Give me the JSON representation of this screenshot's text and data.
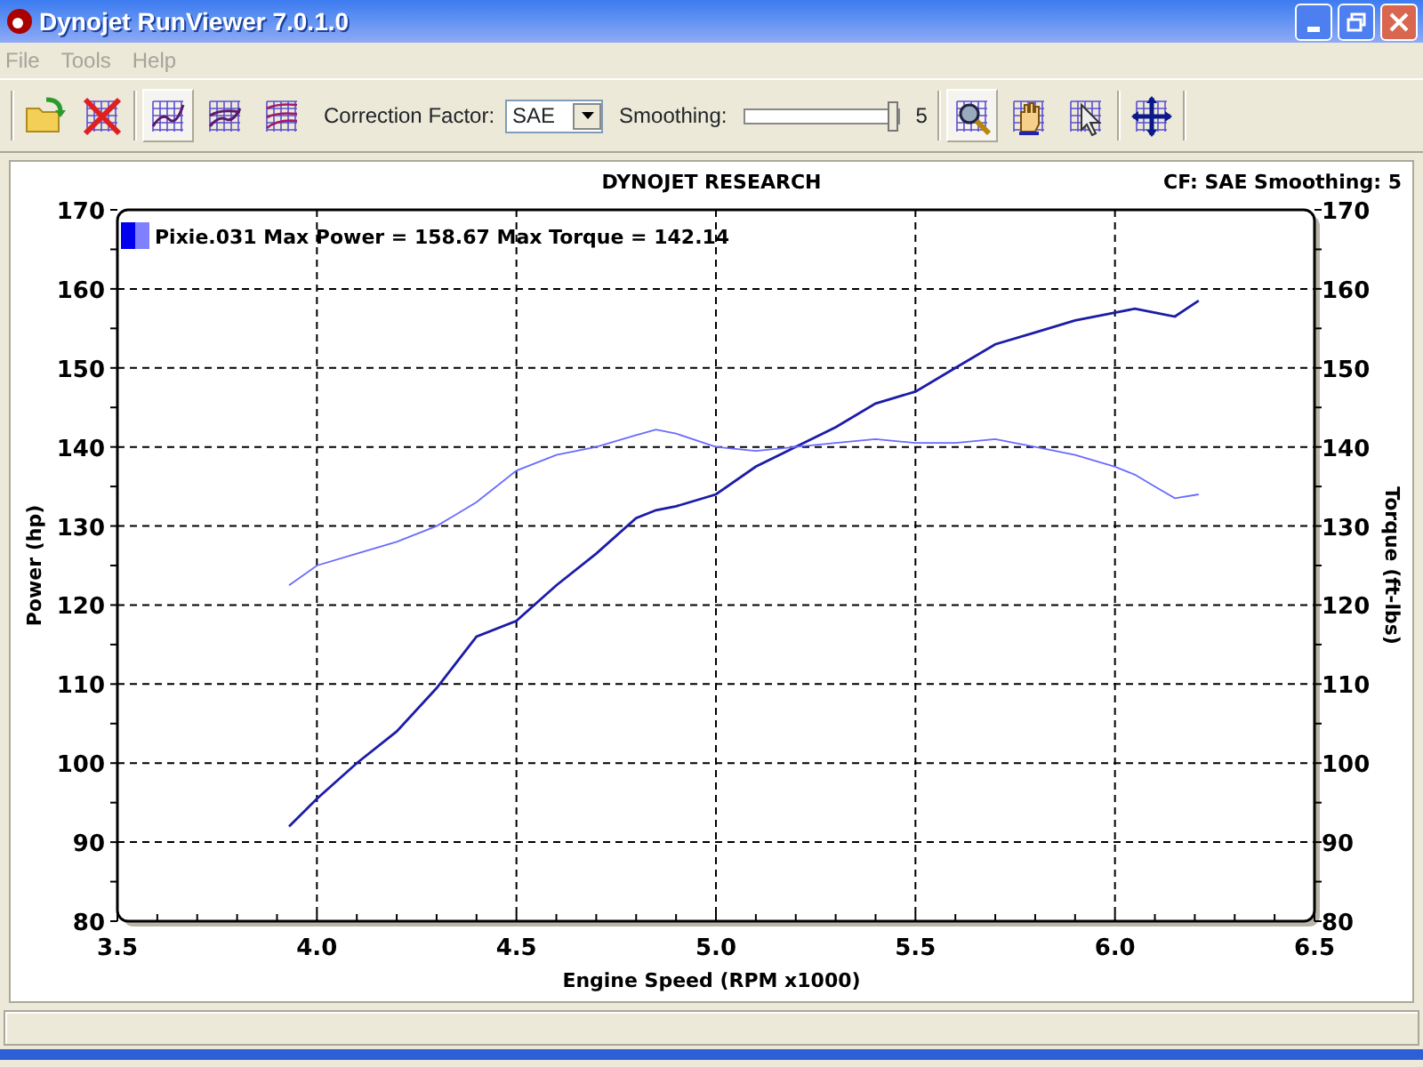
{
  "window": {
    "title": "Dynojet RunViewer 7.0.1.0"
  },
  "menu": [
    "File",
    "Tools",
    "Help"
  ],
  "toolbar": {
    "tools": [
      {
        "kind": "open",
        "selected": false
      },
      {
        "kind": "delete",
        "selected": false
      },
      {
        "kind": "single",
        "selected": true
      },
      {
        "kind": "double",
        "selected": false
      },
      {
        "kind": "triple",
        "selected": false
      }
    ],
    "correction": {
      "label": "Correction Factor:",
      "value": "SAE"
    },
    "smoothing": {
      "label": "Smoothing:",
      "level": 1,
      "value": "5"
    },
    "view_tools": [
      {
        "kind": "zoom",
        "selected": true
      },
      {
        "kind": "pan",
        "selected": false
      },
      {
        "kind": "pointer",
        "selected": false
      },
      {
        "kind": "move",
        "selected": false
      }
    ]
  },
  "chart": {
    "info": "CF: SAE  Smoothing: 5",
    "legend": {
      "text": "Pixie.031 Max Power = 158.67 Max Torque = 142.14",
      "color": "#0000ee"
    },
    "right_axis": {
      "label": "Torque (ft-lbs)",
      "ticks": [
        "170",
        "160",
        "150",
        "140",
        "130",
        "120",
        "110",
        "100",
        "90",
        "80"
      ]
    },
    "chart_data": {
      "type": "line",
      "title": "DYNOJET RESEARCH",
      "xlabel": "Engine Speed (RPM x1000)",
      "ylabel": "Power (hp)",
      "x": [
        3.93,
        4.0,
        4.1,
        4.2,
        4.3,
        4.4,
        4.5,
        4.6,
        4.7,
        4.8,
        4.85,
        4.9,
        5.0,
        5.1,
        5.2,
        5.3,
        5.4,
        5.5,
        5.6,
        5.7,
        5.8,
        5.9,
        6.0,
        6.05,
        6.1,
        6.15,
        6.21
      ],
      "series": [
        {
          "color": "#1c1ca8",
          "values": [
            92,
            95.5,
            100,
            104,
            109.5,
            116,
            118,
            122.5,
            126.5,
            131,
            132,
            132.5,
            134,
            137.5,
            140,
            142.5,
            145.5,
            147,
            150,
            153,
            154.5,
            156,
            157,
            157.5,
            157,
            156.5,
            158.5
          ]
        },
        {
          "color": "#6a6aff",
          "values": [
            122.5,
            125,
            126.5,
            128,
            130,
            133,
            137,
            139,
            140,
            141.5,
            142.2,
            141.7,
            140,
            139.5,
            140,
            140.5,
            141,
            140.5,
            140.5,
            141,
            140,
            139,
            137.5,
            136.5,
            135,
            133.5,
            134
          ]
        }
      ],
      "xlim": [
        3.5,
        6.5
      ],
      "ylim": [
        80,
        170
      ],
      "xticks": [
        {
          "value": 3.5,
          "label": "3.5"
        },
        {
          "value": 4,
          "label": "4.0"
        },
        {
          "value": 4.5,
          "label": "4.5"
        },
        {
          "value": 5,
          "label": "5.0"
        },
        {
          "value": 5.5,
          "label": "5.5"
        },
        {
          "value": 6,
          "label": "6.0"
        },
        {
          "value": 6.5,
          "label": "6.5"
        }
      ],
      "yticks": [
        {
          "value": 80,
          "label": "80"
        },
        {
          "value": 90,
          "label": "90"
        },
        {
          "value": 100,
          "label": "100"
        },
        {
          "value": 110,
          "label": "110"
        },
        {
          "value": 120,
          "label": "120"
        },
        {
          "value": 130,
          "label": "130"
        },
        {
          "value": 140,
          "label": "140"
        },
        {
          "value": 150,
          "label": "150"
        },
        {
          "value": 160,
          "label": "160"
        },
        {
          "value": 170,
          "label": "170"
        }
      ],
      "grid": true
    }
  }
}
